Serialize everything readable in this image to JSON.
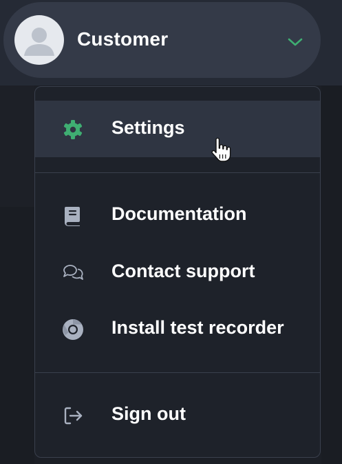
{
  "account": {
    "name": "Customer",
    "avatar_icon": "user-silhouette-icon",
    "toggle_icon": "chevron-down-icon"
  },
  "menu": {
    "sections": [
      {
        "items": [
          {
            "label": "Settings",
            "icon": "gear-icon",
            "icon_color": "#3fae72",
            "hovered": true
          }
        ]
      },
      {
        "items": [
          {
            "label": "Documentation",
            "icon": "book-icon",
            "icon_color": "#a9b1c0"
          },
          {
            "label": "Contact support",
            "icon": "chat-bubbles-icon",
            "icon_color": "#a9b1c0"
          },
          {
            "label": "Install test recorder",
            "icon": "chrome-icon",
            "icon_color": "#a9b1c0"
          }
        ]
      },
      {
        "items": [
          {
            "label": "Sign out",
            "icon": "sign-out-icon",
            "icon_color": "#a9b1c0"
          }
        ]
      }
    ]
  },
  "colors": {
    "accent": "#3fae72",
    "menu_bg": "#1e222a",
    "hover_bg": "#2f3542",
    "pill_bg": "#343a48"
  }
}
